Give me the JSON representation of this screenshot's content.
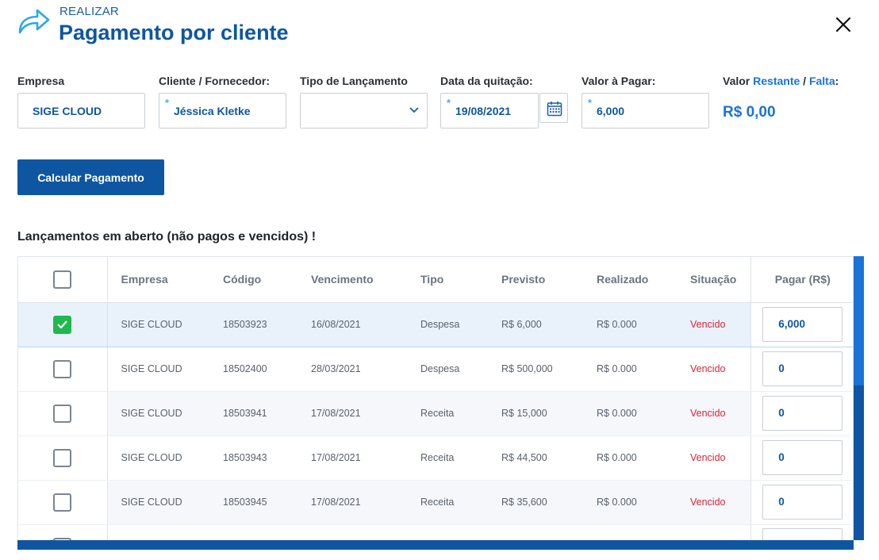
{
  "header": {
    "pretitle": "REALIZAR",
    "title": "Pagamento por cliente",
    "icon": "share-arrow-icon",
    "close_icon": "close-icon"
  },
  "form": {
    "empresa": {
      "label": "Empresa",
      "value": "SIGE CLOUD"
    },
    "cliente": {
      "label": "Cliente / Fornecedor:",
      "value": "Jéssica Kletke",
      "required_mark": "*"
    },
    "tipo": {
      "label": "Tipo de Lançamento",
      "value": ""
    },
    "data": {
      "label": "Data da quitação:",
      "value": "19/08/2021",
      "required_mark": "*"
    },
    "valor": {
      "label": "Valor à Pagar:",
      "value": "6,000",
      "required_mark": "*"
    },
    "restante": {
      "label_prefix": "Valor ",
      "label_restante": "Restante",
      "label_sep": " / ",
      "label_falta": "Falta",
      "label_suffix": ":",
      "value": "R$ 0,00"
    }
  },
  "calc_button": "Calcular Pagamento",
  "section_title": "Lançamentos em aberto (não pagos e vencidos) !",
  "table": {
    "columns": [
      "Empresa",
      "Código",
      "Vencimento",
      "Tipo",
      "Previsto",
      "Realizado",
      "Situação",
      "Pagar (R$)"
    ],
    "rows": [
      {
        "checked": true,
        "empresa": "SIGE CLOUD",
        "codigo": "18503923",
        "vencimento": "16/08/2021",
        "tipo": "Despesa",
        "previsto": "R$ 6,000",
        "realizado": "R$ 0.000",
        "situacao": "Vencido",
        "pagar": "6,000"
      },
      {
        "checked": false,
        "empresa": "SIGE CLOUD",
        "codigo": "18502400",
        "vencimento": "28/03/2021",
        "tipo": "Despesa",
        "previsto": "R$ 500,000",
        "realizado": "R$ 0.000",
        "situacao": "Vencido",
        "pagar": "0"
      },
      {
        "checked": false,
        "empresa": "SIGE CLOUD",
        "codigo": "18503941",
        "vencimento": "17/08/2021",
        "tipo": "Receita",
        "previsto": "R$ 15,000",
        "realizado": "R$ 0.000",
        "situacao": "Vencido",
        "pagar": "0"
      },
      {
        "checked": false,
        "empresa": "SIGE CLOUD",
        "codigo": "18503943",
        "vencimento": "17/08/2021",
        "tipo": "Receita",
        "previsto": "R$ 44,500",
        "realizado": "R$ 0.000",
        "situacao": "Vencido",
        "pagar": "0"
      },
      {
        "checked": false,
        "empresa": "SIGE CLOUD",
        "codigo": "18503945",
        "vencimento": "17/08/2021",
        "tipo": "Receita",
        "previsto": "R$ 35,600",
        "realizado": "R$ 0.000",
        "situacao": "Vencido",
        "pagar": "0"
      },
      {
        "checked": false,
        "empresa": "",
        "codigo": "",
        "vencimento": "",
        "tipo": "",
        "previsto": "",
        "realizado": "",
        "situacao": "",
        "pagar": ""
      }
    ]
  },
  "colors": {
    "primary": "#0e56a1",
    "accent": "#1a73d9",
    "status": "#d9243a",
    "check": "#1fb94e"
  }
}
